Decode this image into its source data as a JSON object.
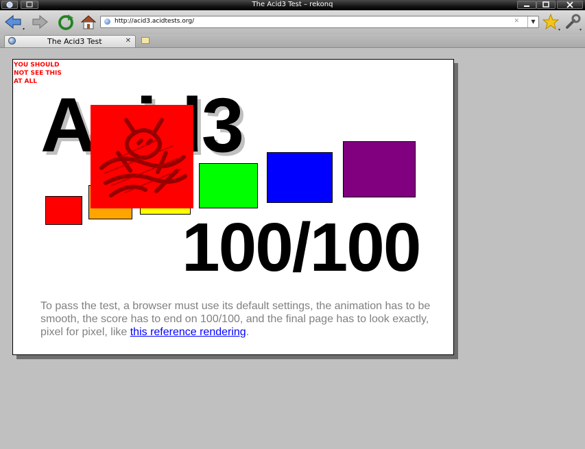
{
  "window": {
    "title": "The Acid3 Test – rekonq"
  },
  "toolbar": {
    "back_icon": "back-arrow-icon",
    "forward_icon": "forward-arrow-icon",
    "reload_icon": "reload-icon",
    "home_icon": "home-icon",
    "bookmark_icon": "star-icon",
    "tools_icon": "wrench-icon"
  },
  "urlbar": {
    "url": "http://acid3.acidtests.org/",
    "clear_label": "✕",
    "dropdown_label": "▼"
  },
  "tabs": [
    {
      "label": "The Acid3 Test",
      "close_label": "✕"
    }
  ],
  "page": {
    "warning": "YOU SHOULD NOT SEE THIS AT ALL",
    "heading": "Acid3",
    "score": "100/100",
    "instructions_text": "To pass the test, a browser must use its default settings, the animation has to be smooth, the score has to end on 100/100, and the final page has to look exactly, pixel for pixel, like ",
    "link_text": "this reference rendering",
    "instructions_end": "."
  },
  "colors": {
    "bucket_1": "#ff0000",
    "bucket_2": "#ffa500",
    "bucket_3": "#ffff00",
    "bucket_4": "#00ff00",
    "bucket_5": "#0000ff",
    "bucket_6": "#800080",
    "overlay": "#ff0000",
    "overlay_mark": "#8b0000"
  }
}
